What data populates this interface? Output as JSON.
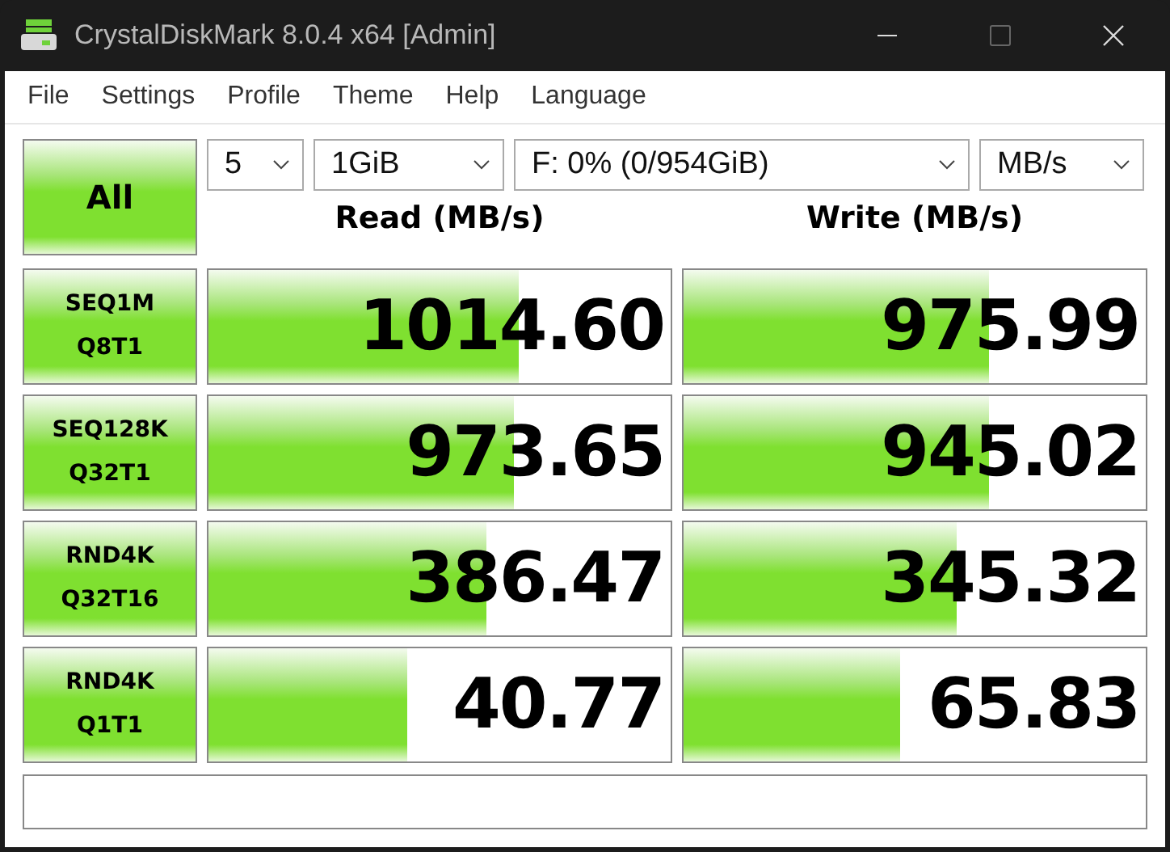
{
  "window": {
    "title": "CrystalDiskMark 8.0.4 x64 [Admin]"
  },
  "menu": [
    "File",
    "Settings",
    "Profile",
    "Theme",
    "Help",
    "Language"
  ],
  "all_button": "All",
  "selectors": [
    {
      "value": "5"
    },
    {
      "value": "1GiB"
    },
    {
      "value": "F: 0% (0/954GiB)"
    },
    {
      "value": "MB/s"
    }
  ],
  "headers": {
    "read": "Read (MB/s)",
    "write": "Write (MB/s)"
  },
  "tests": [
    {
      "name": "SEQ1M",
      "params": "Q8T1",
      "read": {
        "value": "1014.60",
        "level": 0.67
      },
      "write": {
        "value": "975.99",
        "level": 0.66
      }
    },
    {
      "name": "SEQ128K",
      "params": "Q32T1",
      "read": {
        "value": "973.65",
        "level": 0.66
      },
      "write": {
        "value": "945.02",
        "level": 0.66
      }
    },
    {
      "name": "RND4K",
      "params": "Q32T16",
      "read": {
        "value": "386.47",
        "level": 0.6
      },
      "write": {
        "value": "345.32",
        "level": 0.59
      }
    },
    {
      "name": "RND4K",
      "params": "Q1T1",
      "read": {
        "value": "40.77",
        "level": 0.43
      },
      "write": {
        "value": "65.83",
        "level": 0.47
      }
    }
  ]
}
